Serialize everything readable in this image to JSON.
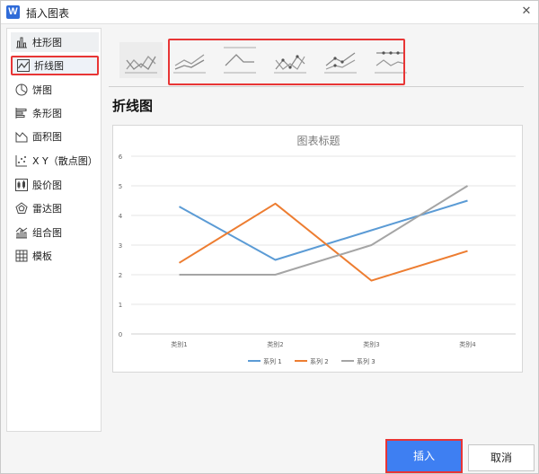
{
  "window": {
    "title": "插入图表",
    "app_icon_letter": "W",
    "close_glyph": "✕"
  },
  "sidebar": {
    "items": [
      {
        "label": "柱形图",
        "icon": "column-chart-icon"
      },
      {
        "label": "折线图",
        "icon": "line-chart-icon"
      },
      {
        "label": "饼图",
        "icon": "pie-chart-icon"
      },
      {
        "label": "条形图",
        "icon": "bar-chart-icon"
      },
      {
        "label": "面积图",
        "icon": "area-chart-icon"
      },
      {
        "label": "X Y（散点图）",
        "icon": "scatter-chart-icon"
      },
      {
        "label": "股价图",
        "icon": "stock-chart-icon"
      },
      {
        "label": "雷达图",
        "icon": "radar-chart-icon"
      },
      {
        "label": "组合图",
        "icon": "combo-chart-icon"
      },
      {
        "label": "模板",
        "icon": "template-icon"
      }
    ],
    "selected_index": 1
  },
  "section_title": "折线图",
  "chart_data": {
    "type": "line",
    "title": "图表标题",
    "categories": [
      "类别1",
      "类别2",
      "类别3",
      "类别4"
    ],
    "series": [
      {
        "name": "系列 1",
        "values": [
          4.3,
          2.5,
          3.5,
          4.5
        ],
        "color": "#5b9bd5"
      },
      {
        "name": "系列 2",
        "values": [
          2.4,
          4.4,
          1.8,
          2.8
        ],
        "color": "#ed7d31"
      },
      {
        "name": "系列 3",
        "values": [
          2.0,
          2.0,
          3.0,
          5.0
        ],
        "color": "#a5a5a5"
      }
    ],
    "ylim": [
      0,
      6
    ],
    "yticks": [
      "0",
      "1",
      "2",
      "3",
      "4",
      "5",
      "6"
    ],
    "grid": true,
    "legend": "bottom"
  },
  "buttons": {
    "insert": "插入",
    "cancel": "取消"
  }
}
